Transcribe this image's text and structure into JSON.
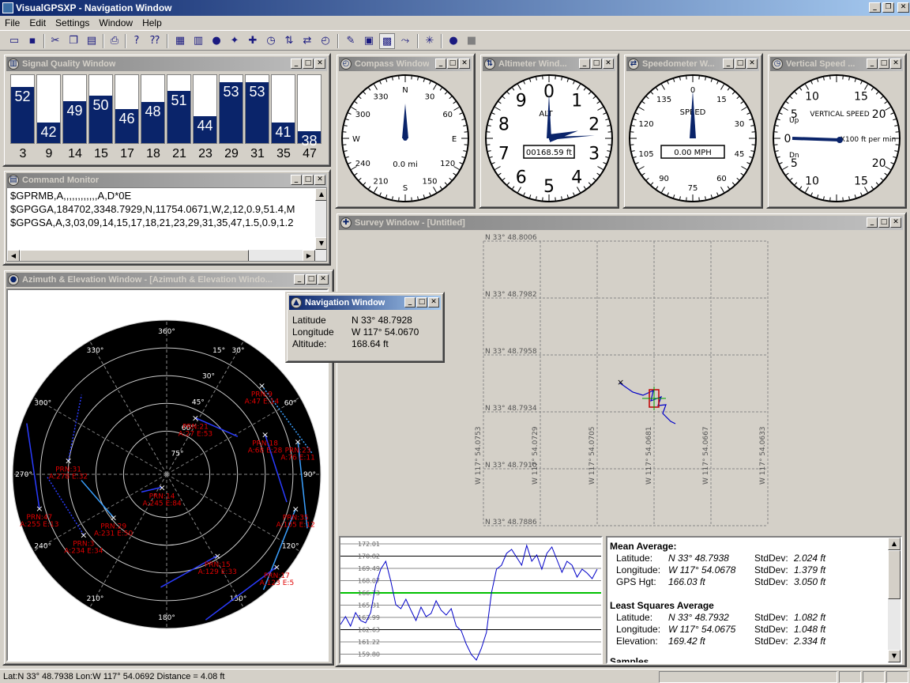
{
  "window": {
    "title": "VisualGPSXP - Navigation Window"
  },
  "menu": [
    "File",
    "Edit",
    "Settings",
    "Window",
    "Help"
  ],
  "toolbar_icons": [
    "open-icon",
    "save-icon",
    "cut-icon",
    "copy-icon",
    "paste-icon",
    "print-icon",
    "help-icon",
    "context-help-icon",
    "signal-icon",
    "bar-chart-icon",
    "globe-icon",
    "gps-icon",
    "grid-icon",
    "clock-icon",
    "altitude-icon",
    "speed-icon",
    "compass-icon",
    "navigation-icon",
    "pen-icon",
    "monitor-icon",
    "route-icon",
    "satellite-icon",
    "record-icon",
    "stop-icon"
  ],
  "signal_quality": {
    "title": "Signal Quality Window",
    "satellites": [
      {
        "prn": "3",
        "snr": "52",
        "level": 0.82
      },
      {
        "prn": "9",
        "snr": "42",
        "level": 0.3
      },
      {
        "prn": "14",
        "snr": "49",
        "level": 0.62
      },
      {
        "prn": "15",
        "snr": "50",
        "level": 0.7
      },
      {
        "prn": "17",
        "snr": "46",
        "level": 0.5
      },
      {
        "prn": "18",
        "snr": "48",
        "level": 0.6
      },
      {
        "prn": "21",
        "snr": "51",
        "level": 0.77
      },
      {
        "prn": "23",
        "snr": "44",
        "level": 0.4
      },
      {
        "prn": "29",
        "snr": "53",
        "level": 0.9
      },
      {
        "prn": "31",
        "snr": "53",
        "level": 0.9
      },
      {
        "prn": "35",
        "snr": "41",
        "level": 0.3
      },
      {
        "prn": "47",
        "snr": "38",
        "level": 0.18
      }
    ]
  },
  "command_monitor": {
    "title": "Command Monitor",
    "lines": [
      "$GPRMB,A,,,,,,,,,,,,A,D*0E",
      "$GPGGA,184702,3348.7929,N,11754.0671,W,2,12,0.9,51.4,M",
      "$GPGSA,A,3,03,09,14,15,17,18,21,23,29,31,35,47,1.5,0.9,1.2"
    ]
  },
  "compass": {
    "title": "Compass Window",
    "ticks": [
      "N",
      "30",
      "60",
      "E",
      "120",
      "150",
      "S",
      "210",
      "240",
      "W",
      "300",
      "330"
    ],
    "heading_deg": 0,
    "distance": "0.0 mi"
  },
  "altimeter": {
    "title": "Altimeter Wind...",
    "numbers": [
      "0",
      "1",
      "2",
      "3",
      "4",
      "5",
      "6",
      "7",
      "8",
      "9"
    ],
    "label": "ALT",
    "readout": "00168.59 ft"
  },
  "speedometer": {
    "title": "Speedometer W...",
    "ticks": [
      "0",
      "15",
      "30",
      "45",
      "60",
      "75",
      "90",
      "105",
      "120",
      "135"
    ],
    "label": "SPEED",
    "readout": "0.00 MPH"
  },
  "vertical_speed": {
    "title": "Vertical Speed ...",
    "label": "VERTICAL SPEED",
    "units": "X100 ft per min",
    "up": "Up",
    "dn": "Dn",
    "ticks": [
      "0",
      "5",
      "10",
      "15",
      "20",
      "20",
      "15",
      "10",
      "5"
    ]
  },
  "azimuth": {
    "title": "Azimuth & Elevation Window - [Azimuth & Elevation Windo...",
    "az_labels": [
      "360°",
      "30°",
      "60°",
      "90°",
      "120°",
      "150°",
      "180°",
      "210°",
      "240°",
      "270°",
      "300°",
      "330°"
    ],
    "el_labels": [
      "15°",
      "30°",
      "45°",
      "60°",
      "75°"
    ],
    "sats": [
      {
        "prn": "PRN:9",
        "ae": "A:47 E:14",
        "az": 47,
        "el": 14
      },
      {
        "prn": "PRN:21",
        "ae": "A:27 E:53",
        "az": 27,
        "el": 53
      },
      {
        "prn": "PRN:18",
        "ae": "A:68 E:28",
        "az": 68,
        "el": 28
      },
      {
        "prn": "PRN:23",
        "ae": "A:76 E:11",
        "az": 76,
        "el": 11
      },
      {
        "prn": "PRN:31",
        "ae": "A:278 E:32",
        "az": 278,
        "el": 32
      },
      {
        "prn": "PRN:14",
        "ae": "A:245 E:84",
        "az": 200,
        "el": 82
      },
      {
        "prn": "PRN:29",
        "ae": "A:231 E:50",
        "az": 231,
        "el": 50
      },
      {
        "prn": "PRN:47",
        "ae": "A:255 E:13",
        "az": 255,
        "el": 13
      },
      {
        "prn": "PRN:3",
        "ae": "A:234 E:34",
        "az": 234,
        "el": 30
      },
      {
        "prn": "PRN:35",
        "ae": "A:105 E:12",
        "az": 105,
        "el": 12
      },
      {
        "prn": "PRN:15",
        "ae": "A:129 E:33",
        "az": 148,
        "el": 34
      },
      {
        "prn": "PRN:17",
        "ae": "A:123 E:5",
        "az": 130,
        "el": 6
      }
    ]
  },
  "navigation": {
    "title": "Navigation Window",
    "latitude_label": "Latitude",
    "latitude": "N 33° 48.7928",
    "longitude_label": "Longitude",
    "longitude": "W 117° 54.0670",
    "altitude_label": "Altitude:",
    "altitude": "168.64  ft"
  },
  "survey": {
    "title": "Survey Window - [Untitled]",
    "lat_labels": [
      "N 33° 48.8006",
      "N 33° 48.7982",
      "N 33° 48.7958",
      "N 33° 48.7934",
      "N 33° 48.7910",
      "N 33° 48.7886"
    ],
    "lon_labels": [
      "W 117° 54.0753",
      "W 117° 54.0729",
      "W 117° 54.0705",
      "W 117° 54.0681",
      "W 117° 54.0667",
      "W 117° 54.0633"
    ]
  },
  "altitude_chart": {
    "y_labels": [
      "172.01",
      "170.82",
      "169.49",
      "168.07",
      "166.73",
      "165.31",
      "163.99",
      "162.63",
      "161.22",
      "159.80"
    ]
  },
  "stats": {
    "mean_title": "Mean Average:",
    "mean": [
      {
        "label": "Latitude:",
        "value": "N 33° 48.7938",
        "sd_label": "StdDev:",
        "sd": "2.024 ft"
      },
      {
        "label": "Longitude:",
        "value": "W 117° 54.0678",
        "sd_label": "StdDev:",
        "sd": "1.379 ft"
      },
      {
        "label": "GPS Hgt:",
        "value": "166.03  ft",
        "sd_label": "StdDev:",
        "sd": "3.050 ft"
      }
    ],
    "ls_title": "Least Squares Average",
    "ls": [
      {
        "label": "Latitude:",
        "value": "N 33° 48.7932",
        "sd_label": "StdDev:",
        "sd": "1.082 ft"
      },
      {
        "label": "Longitude:",
        "value": "W 117° 54.0675",
        "sd_label": "StdDev:",
        "sd": "1.048 ft"
      },
      {
        "label": "Elevation:",
        "value": "169.42  ft",
        "sd_label": "StdDev:",
        "sd": "2.334 ft"
      }
    ],
    "samples_title": "Samples"
  },
  "status": {
    "text": "Lat:N 33° 48.7938   Lon:W 117° 54.0692   Distance = 4.08 ft"
  },
  "colors": {
    "accent": "#0a246a",
    "sat_label": "#e00000",
    "track": "#0000c8"
  }
}
